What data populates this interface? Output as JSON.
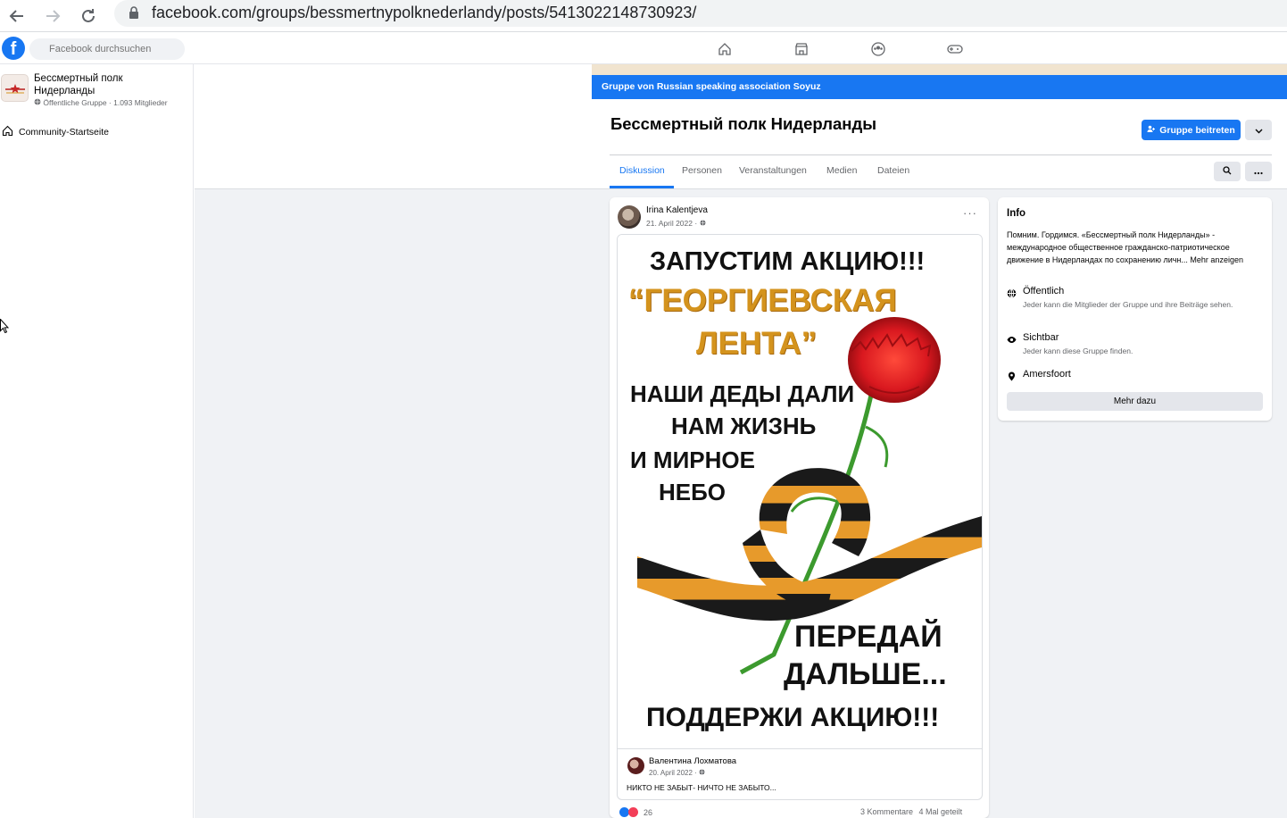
{
  "browser": {
    "url": "facebook.com/groups/bessmertnypolknederlandy/posts/5413022148730923/"
  },
  "facebook": {
    "logo": "f",
    "search_placeholder": "Facebook durchsuchen",
    "nav_icons": [
      "home-icon",
      "marketplace-icon",
      "groups-icon",
      "gaming-icon"
    ]
  },
  "sidebar": {
    "group_name": "Бессмертный полк Нидерланды",
    "group_meta": "Öffentliche Gruppe · 1.093 Mitglieder",
    "community_link": "Community-Startseite"
  },
  "group": {
    "parent_banner": "Gruppe von Russian speaking association Soyuz",
    "title": "Бессмертный полк Нидерланды",
    "join_label": "Gruppe beitreten",
    "tabs": [
      "Diskussion",
      "Personen",
      "Veranstaltungen",
      "Medien",
      "Dateien"
    ],
    "active_tab": "Diskussion"
  },
  "post": {
    "author": "Irina Kalentjeva",
    "date": "21. April 2022 · ",
    "menu": "···",
    "poster": {
      "line1": "ЗАПУСТИМ АКЦИЮ!!!",
      "line2": "“ГЕОРГИЕВСКАЯ",
      "line3": "ЛЕНТА”",
      "line4": "НАШИ ДЕДЫ ДАЛИ",
      "line5": "НАМ ЖИЗНЬ",
      "line6": "И МИРНОЕ",
      "line7": "НЕБО",
      "line8": "ПЕРЕДАЙ",
      "line9": "ДАЛЬШЕ...",
      "line10": "ПОДДЕРЖИ АКЦИЮ!!!"
    },
    "shared": {
      "author": "Валентина Лохматова",
      "date": "20. April 2022 · ",
      "text": "НИКТО НЕ ЗАБЫТ- НИЧТО НЕ ЗАБЫТО..."
    },
    "reaction_count": "26",
    "comments": "3 Kommentare",
    "shares": "4 Mal geteilt"
  },
  "info": {
    "title": "Info",
    "description": "Помним. Гордимся. «Бессмертный полк Нидерланды» - международное общественное гражданско-патриотическое движение в Нидерландах по сохранению личн...",
    "more": "Mehr anzeigen",
    "rows": [
      {
        "icon": "globe-icon",
        "title": "Öffentlich",
        "sub": "Jeder kann die Mitglieder der Gruppe und ihre Beiträge sehen."
      },
      {
        "icon": "eye-icon",
        "title": "Sichtbar",
        "sub": "Jeder kann diese Gruppe finden."
      },
      {
        "icon": "location-pin-icon",
        "title": "Amersfoort",
        "sub": ""
      }
    ],
    "button": "Mehr dazu"
  },
  "colors": {
    "accent": "#1877f2",
    "cover": "#f1e4cf",
    "background": "#f0f2f5"
  }
}
